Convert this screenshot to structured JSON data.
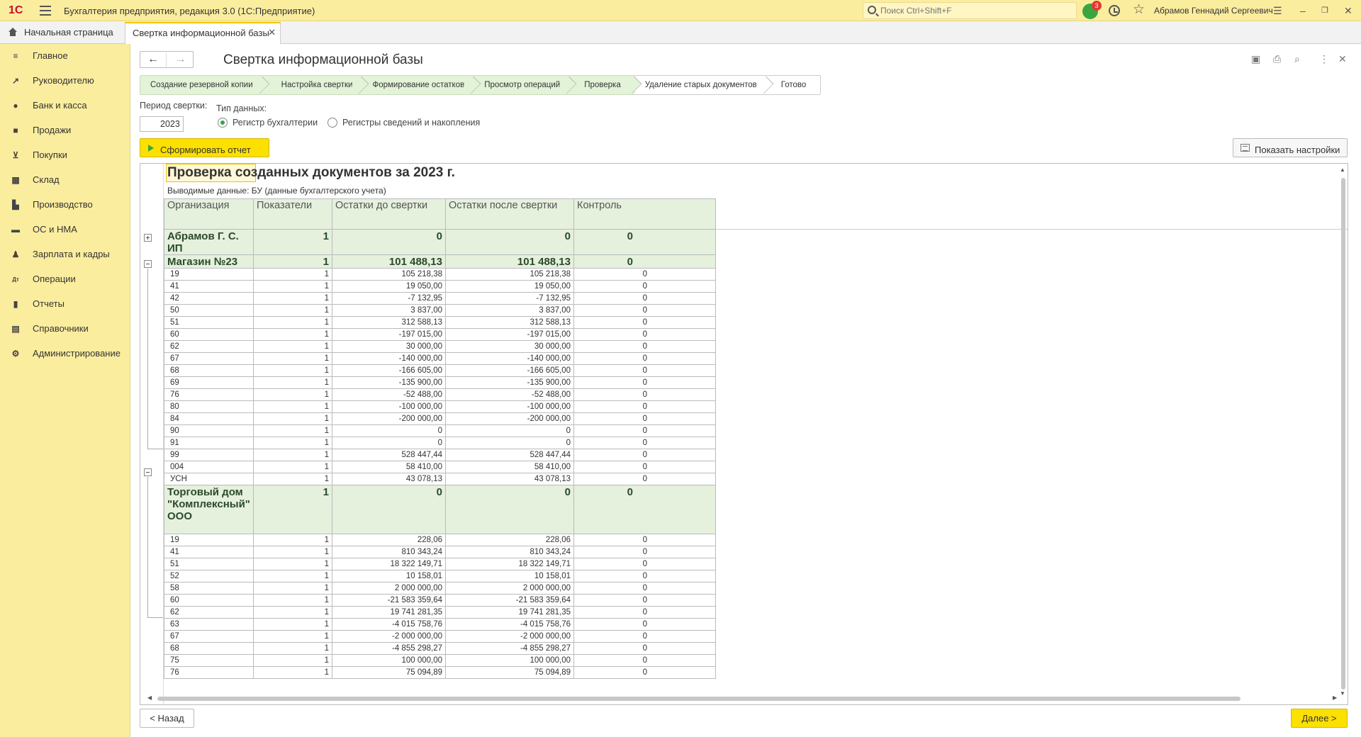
{
  "app": {
    "logo": "1С",
    "title": "Бухгалтерия предприятия, редакция 3.0  (1С:Предприятие)",
    "search_placeholder": "Поиск Ctrl+Shift+F",
    "notifications_count": "3",
    "user": "Абрамов Геннадий Сергеевич"
  },
  "tabs": {
    "home": "Начальная страница",
    "active": "Свертка информационной базы"
  },
  "sidebar": {
    "items": [
      {
        "label": "Главное",
        "icon": "menu-icon"
      },
      {
        "label": "Руководителю",
        "icon": "trend-icon"
      },
      {
        "label": "Банк и касса",
        "icon": "coin-icon"
      },
      {
        "label": "Продажи",
        "icon": "bag-icon"
      },
      {
        "label": "Покупки",
        "icon": "cart-icon"
      },
      {
        "label": "Склад",
        "icon": "warehouse-icon"
      },
      {
        "label": "Производство",
        "icon": "factory-icon"
      },
      {
        "label": "ОС и НМА",
        "icon": "truck-icon"
      },
      {
        "label": "Зарплата и кадры",
        "icon": "person-icon"
      },
      {
        "label": "Операции",
        "icon": "debit-credit-icon"
      },
      {
        "label": "Отчеты",
        "icon": "bar-chart-icon"
      },
      {
        "label": "Справочники",
        "icon": "book-icon"
      },
      {
        "label": "Администрирование",
        "icon": "gear-icon"
      }
    ]
  },
  "form": {
    "title": "Свертка информационной базы",
    "steps": [
      "Создание резервной копии",
      "Настройка свертки",
      "Формирование остатков",
      "Просмотр операций",
      "Проверка",
      "Удаление старых документов",
      "Готово"
    ],
    "period_label": "Период свертки:",
    "period_value": "2023",
    "datatype_label": "Тип данных:",
    "radio_accounting": "Регистр бухгалтерии",
    "radio_registers": "Регистры сведений и накопления",
    "generate_button": "Сформировать отчет",
    "settings_button": "Показать настройки",
    "back_button": "< Назад",
    "next_button": "Далее >"
  },
  "report": {
    "title": "Проверка созданных документов за 2023 г.",
    "subtitle": "Выводимые данные: БУ (данные бухгалтерского учета)",
    "headers": [
      "Организация",
      "Показатели",
      "Остатки до свертки",
      "Остатки после свертки",
      "Контроль"
    ],
    "groups": [
      {
        "name": "Абрамов Г. С. ИП",
        "indicator": "1",
        "before": "0",
        "after": "0",
        "control": "0",
        "collapsed": true,
        "rows": []
      },
      {
        "name": "Магазин №23",
        "indicator": "1",
        "before": "101 488,13",
        "after": "101 488,13",
        "control": "0",
        "collapsed": false,
        "rows": [
          [
            "19",
            "1",
            "105 218,38",
            "105 218,38",
            "0"
          ],
          [
            "41",
            "1",
            "19 050,00",
            "19 050,00",
            "0"
          ],
          [
            "42",
            "1",
            "-7 132,95",
            "-7 132,95",
            "0"
          ],
          [
            "50",
            "1",
            "3 837,00",
            "3 837,00",
            "0"
          ],
          [
            "51",
            "1",
            "312 588,13",
            "312 588,13",
            "0"
          ],
          [
            "60",
            "1",
            "-197 015,00",
            "-197 015,00",
            "0"
          ],
          [
            "62",
            "1",
            "30 000,00",
            "30 000,00",
            "0"
          ],
          [
            "67",
            "1",
            "-140 000,00",
            "-140 000,00",
            "0"
          ],
          [
            "68",
            "1",
            "-166 605,00",
            "-166 605,00",
            "0"
          ],
          [
            "69",
            "1",
            "-135 900,00",
            "-135 900,00",
            "0"
          ],
          [
            "76",
            "1",
            "-52 488,00",
            "-52 488,00",
            "0"
          ],
          [
            "80",
            "1",
            "-100 000,00",
            "-100 000,00",
            "0"
          ],
          [
            "84",
            "1",
            "-200 000,00",
            "-200 000,00",
            "0"
          ],
          [
            "90",
            "1",
            "0",
            "0",
            "0"
          ],
          [
            "91",
            "1",
            "0",
            "0",
            "0"
          ],
          [
            "99",
            "1",
            "528 447,44",
            "528 447,44",
            "0"
          ],
          [
            "004",
            "1",
            "58 410,00",
            "58 410,00",
            "0"
          ],
          [
            "УСН",
            "1",
            "43 078,13",
            "43 078,13",
            "0"
          ]
        ]
      },
      {
        "name": "Торговый дом \"Комплексный\" ООО",
        "indicator": "1",
        "before": "0",
        "after": "0",
        "control": "0",
        "collapsed": false,
        "rows": [
          [
            "19",
            "1",
            "228,06",
            "228,06",
            "0"
          ],
          [
            "41",
            "1",
            "810 343,24",
            "810 343,24",
            "0"
          ],
          [
            "51",
            "1",
            "18 322 149,71",
            "18 322 149,71",
            "0"
          ],
          [
            "52",
            "1",
            "10 158,01",
            "10 158,01",
            "0"
          ],
          [
            "58",
            "1",
            "2 000 000,00",
            "2 000 000,00",
            "0"
          ],
          [
            "60",
            "1",
            "-21 583 359,64",
            "-21 583 359,64",
            "0"
          ],
          [
            "62",
            "1",
            "19 741 281,35",
            "19 741 281,35",
            "0"
          ],
          [
            "63",
            "1",
            "-4 015 758,76",
            "-4 015 758,76",
            "0"
          ],
          [
            "67",
            "1",
            "-2 000 000,00",
            "-2 000 000,00",
            "0"
          ],
          [
            "68",
            "1",
            "-4 855 298,27",
            "-4 855 298,27",
            "0"
          ],
          [
            "75",
            "1",
            "100 000,00",
            "100 000,00",
            "0"
          ],
          [
            "76",
            "1",
            "75 094,89",
            "75 094,89",
            "0"
          ]
        ]
      }
    ]
  },
  "colors": {
    "accent": "#fbe000",
    "panel": "#fbed9e",
    "group_bg": "#e5f0dd",
    "step_done": "#e3f3d8"
  }
}
